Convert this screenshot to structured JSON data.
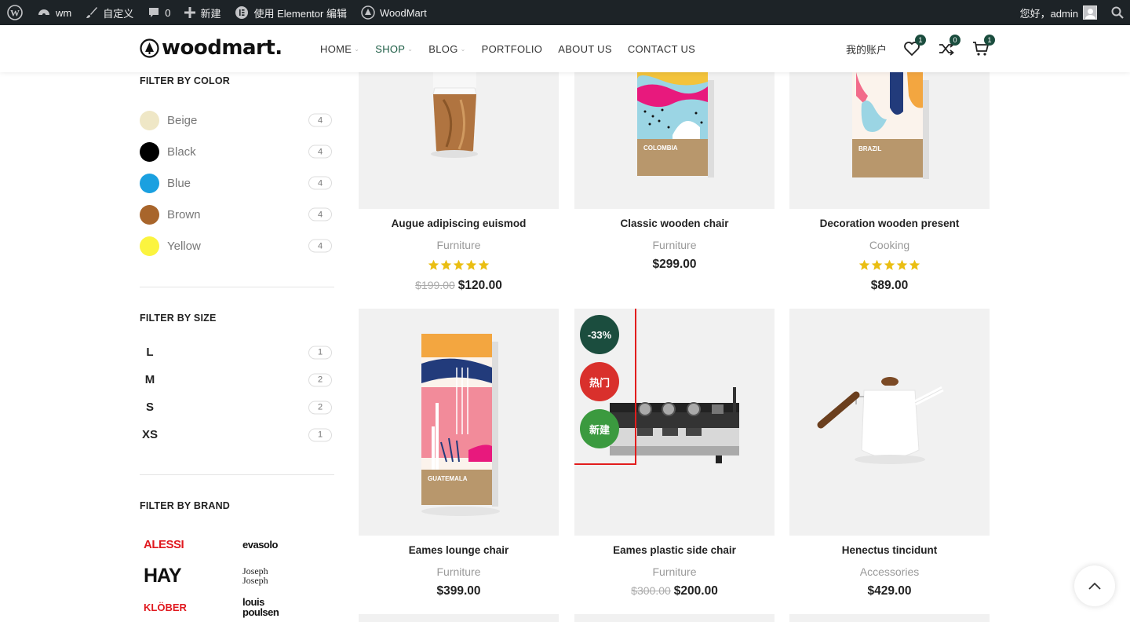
{
  "adminbar": {
    "site_name": "wm",
    "customize": "自定义",
    "comments_count": "0",
    "new": "新建",
    "elementor": "使用 Elementor 编辑",
    "woodmart": "WoodMart",
    "greeting": "您好，admin"
  },
  "header": {
    "logo_text": "woodmart.",
    "nav": [
      {
        "label": "HOME"
      },
      {
        "label": "SHOP"
      },
      {
        "label": "BLOG"
      },
      {
        "label": "PORTFOLIO"
      },
      {
        "label": "ABOUT US"
      },
      {
        "label": "CONTACT US"
      }
    ],
    "account": "我的账户",
    "wishlist_count": "1",
    "compare_count": "0",
    "cart_count": "1"
  },
  "sidebar": {
    "color_title": "FILTER BY COLOR",
    "colors": [
      {
        "name": "Beige",
        "count": "4",
        "hex": "#efe7c6"
      },
      {
        "name": "Black",
        "count": "4",
        "hex": "#000000"
      },
      {
        "name": "Blue",
        "count": "4",
        "hex": "#1aa0e0"
      },
      {
        "name": "Brown",
        "count": "4",
        "hex": "#a8652b"
      },
      {
        "name": "Yellow",
        "count": "4",
        "hex": "#fbf43f"
      }
    ],
    "size_title": "FILTER BY SIZE",
    "sizes": [
      {
        "name": "L",
        "count": "1"
      },
      {
        "name": "M",
        "count": "2"
      },
      {
        "name": "S",
        "count": "2"
      },
      {
        "name": "XS",
        "count": "1"
      }
    ],
    "brand_title": "FILTER BY BRAND",
    "brands": [
      "ALESSI",
      "evasolo",
      "HAY",
      "Joseph Joseph",
      "KLÖBER",
      "louis poulsen"
    ]
  },
  "products": [
    {
      "title": "Augue adipiscing euismod",
      "category": "Furniture",
      "rating": 5,
      "old_price": "$199.00",
      "price": "$120.00"
    },
    {
      "title": "Classic wooden chair",
      "category": "Furniture",
      "rating": 0,
      "old_price": "",
      "price": "$299.00",
      "bag_label": "COLOMBIA"
    },
    {
      "title": "Decoration wooden present",
      "category": "Cooking",
      "rating": 5,
      "old_price": "",
      "price": "$89.00",
      "bag_label": "BRAZIL"
    },
    {
      "title": "Eames lounge chair",
      "category": "Furniture",
      "rating": 0,
      "old_price": "",
      "price": "$399.00",
      "bag_label": "GUATEMALA"
    },
    {
      "title": "Eames plastic side chair",
      "category": "Furniture",
      "rating": 0,
      "old_price": "$300.00",
      "price": "$200.00",
      "labels": [
        "-33%",
        "热门",
        "新建"
      ]
    },
    {
      "title": "Henectus tincidunt",
      "category": "Accessories",
      "rating": 0,
      "old_price": "",
      "price": "$429.00"
    }
  ],
  "colors": {
    "brand_green": "#1b4d3e",
    "hot_red": "#d9302c",
    "new_green": "#3b9a3f",
    "star": "#eabe12",
    "highlight": "#e21d1d"
  }
}
